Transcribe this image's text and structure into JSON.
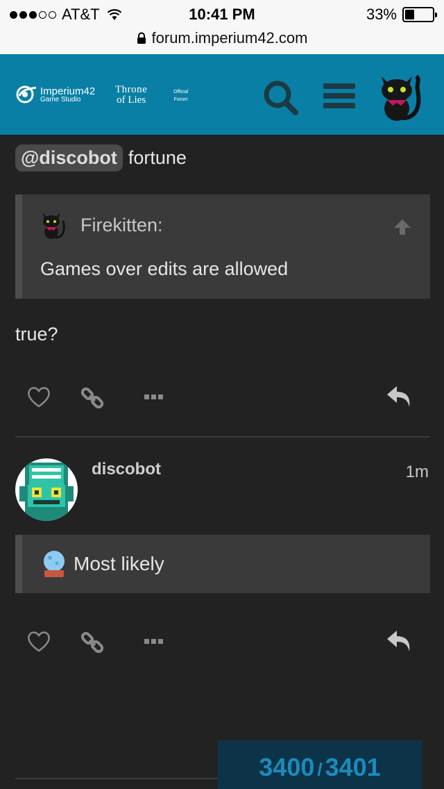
{
  "status_bar": {
    "carrier": "AT&T",
    "time": "10:41 PM",
    "battery": "33%",
    "battery_level": 0.33,
    "url": "forum.imperium42.com"
  },
  "header": {
    "logo_imperium_name": "Imperium42",
    "logo_imperium_sub": "Game Studio",
    "logo_throne_line1": "Throne",
    "logo_throne_line2": "of Lies",
    "logo_official_line1": "Official",
    "logo_official_line2": "Forum",
    "search_icon": "search-icon",
    "menu_icon": "hamburger-menu-icon",
    "accent": "#0a7fa5"
  },
  "post1": {
    "mention": "@discobot",
    "command": "fortune",
    "quote": {
      "author": "Firekitten:",
      "text": "Games over edits are allowed"
    },
    "text": "true?"
  },
  "post2": {
    "username": "discobot",
    "time": "1m",
    "reply": "Most likely"
  },
  "progress": {
    "current": "3400",
    "separator": "/",
    "total": "3401"
  }
}
